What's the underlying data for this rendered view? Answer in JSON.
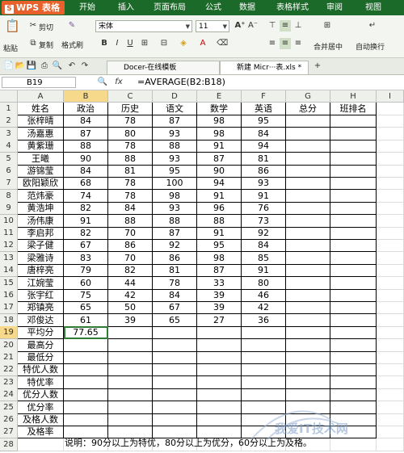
{
  "app": {
    "name": "WPS 表格",
    "logo_letter": "S"
  },
  "menu": [
    "开始",
    "插入",
    "页面布局",
    "公式",
    "数据",
    "表格样式",
    "审阅",
    "视图"
  ],
  "ribbon": {
    "paste": "粘贴",
    "cut": "剪切",
    "copy": "复制",
    "format_painter": "格式刷",
    "font": "宋体",
    "size": "11",
    "merge": "合并居中",
    "wrap": "自动换行"
  },
  "tabs": [
    {
      "label": "Docer-在线模板"
    },
    {
      "label": "新建 Micr···表.xls *"
    }
  ],
  "formula": {
    "cell_ref": "B19",
    "fx": "fx",
    "content": "=AVERAGE(B2:B18)"
  },
  "columns": [
    "A",
    "B",
    "C",
    "D",
    "E",
    "F",
    "G",
    "H",
    "I"
  ],
  "rows": [
    [
      "姓名",
      "政治",
      "历史",
      "语文",
      "数学",
      "英语",
      "总分",
      "班排名"
    ],
    [
      "张梓晴",
      "84",
      "78",
      "87",
      "98",
      "95",
      "",
      ""
    ],
    [
      "汤嘉惠",
      "87",
      "80",
      "93",
      "98",
      "84",
      "",
      ""
    ],
    [
      "黄紫珊",
      "88",
      "78",
      "88",
      "91",
      "94",
      "",
      ""
    ],
    [
      "王曦",
      "90",
      "88",
      "93",
      "87",
      "81",
      "",
      ""
    ],
    [
      "游锦莹",
      "84",
      "81",
      "95",
      "90",
      "86",
      "",
      ""
    ],
    [
      "欧阳颖欣",
      "68",
      "78",
      "100",
      "94",
      "93",
      "",
      ""
    ],
    [
      "范炜豪",
      "74",
      "78",
      "98",
      "91",
      "91",
      "",
      ""
    ],
    [
      "黄浩坤",
      "82",
      "84",
      "93",
      "96",
      "76",
      "",
      ""
    ],
    [
      "汤伟康",
      "91",
      "88",
      "88",
      "88",
      "73",
      "",
      ""
    ],
    [
      "李启邦",
      "82",
      "70",
      "87",
      "91",
      "92",
      "",
      ""
    ],
    [
      "梁子健",
      "67",
      "86",
      "92",
      "95",
      "84",
      "",
      ""
    ],
    [
      "梁雅诗",
      "83",
      "70",
      "86",
      "98",
      "85",
      "",
      ""
    ],
    [
      "唐梓亮",
      "79",
      "82",
      "81",
      "87",
      "91",
      "",
      ""
    ],
    [
      "江婉莹",
      "60",
      "44",
      "78",
      "33",
      "80",
      "",
      ""
    ],
    [
      "张宇红",
      "75",
      "42",
      "84",
      "39",
      "46",
      "",
      ""
    ],
    [
      "郑镇亮",
      "65",
      "50",
      "67",
      "39",
      "42",
      "",
      ""
    ],
    [
      "邓俊达",
      "61",
      "39",
      "65",
      "27",
      "36",
      "",
      ""
    ],
    [
      "平均分",
      "77.65",
      "",
      "",
      "",
      "",
      "",
      ""
    ],
    [
      "最高分",
      "",
      "",
      "",
      "",
      "",
      "",
      ""
    ],
    [
      "最低分",
      "",
      "",
      "",
      "",
      "",
      "",
      ""
    ],
    [
      "特优人数",
      "",
      "",
      "",
      "",
      "",
      "",
      ""
    ],
    [
      "特优率",
      "",
      "",
      "",
      "",
      "",
      "",
      ""
    ],
    [
      "优分人数",
      "",
      "",
      "",
      "",
      "",
      "",
      ""
    ],
    [
      "优分率",
      "",
      "",
      "",
      "",
      "",
      "",
      ""
    ],
    [
      "及格人数",
      "",
      "",
      "",
      "",
      "",
      "",
      ""
    ],
    [
      "及格率",
      "",
      "",
      "",
      "",
      "",
      "",
      ""
    ],
    [
      "",
      "",
      "",
      "",
      "",
      "",
      "",
      ""
    ]
  ],
  "note": "说明：90分以上为特优，80分以上为优分，60分以上为及格。",
  "watermark": "我爱IT技术网"
}
